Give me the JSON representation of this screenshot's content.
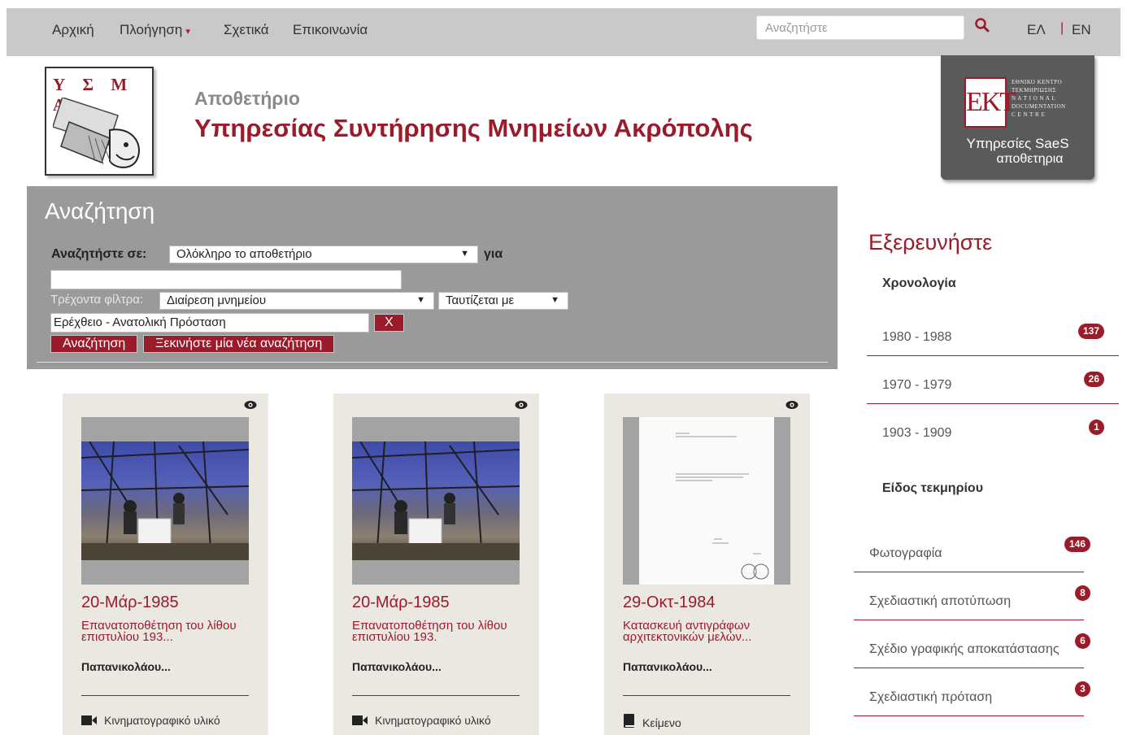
{
  "nav": {
    "home": "Αρχική",
    "browse": "Πλοήγηση",
    "about": "Σχετικά",
    "contact": "Επικοινωνία",
    "search_placeholder": "Αναζητήστε",
    "lang_el": "ΕΛ",
    "lang_sep": "|",
    "lang_en": "EN"
  },
  "header": {
    "logo_text": "Υ Σ Μ Α",
    "subtitle": "Αποθετήριο",
    "title": "Υπηρεσίας Συντήρησης Μνημείων Ακρόπολης",
    "ekt_mark": "EKT",
    "ekt_lines": [
      "ΕΘΝΙΚΟ ΚΕΝΤΡΟ",
      "ΤΕΚΜΗΡΙΩΣΗΣ",
      "N A T I O N A L",
      "DOCUMENTATION",
      "C E N T R E"
    ],
    "ekt_services": "Υπηρεσίες SaeS",
    "ekt_repos": "αποθετηρια"
  },
  "search": {
    "heading": "Αναζήτηση",
    "search_in_label": "Αναζητήστε σε:",
    "scope_value": "Ολόκληρο το αποθετήριο",
    "for_label": "για",
    "query_value": "",
    "filters_label": "Τρέχοντα φίλτρα:",
    "filter_field": "Διαίρεση μνημείου",
    "filter_op": "Ταυτίζεται με",
    "filter_value": "Ερέχθειο - Ανατολική Πρόσταση",
    "remove_label": "X",
    "search_btn": "Αναζήτηση",
    "new_search_btn": "Ξεκινήστε μία νέα αναζήτηση"
  },
  "cards": [
    {
      "date": "20-Μάρ-1985",
      "title": "Επανατοποθέτηση του λίθου επιστυλίου 193...",
      "author": "Παπανικολάου...",
      "type": "Κινηματογραφικό υλικό",
      "type_icon": "video-camera-icon"
    },
    {
      "date": "20-Μάρ-1985",
      "title": "Επανατοποθέτηση του λίθου επιστυλίου 193.",
      "author": "Παπανικολάου...",
      "type": "Κινηματογραφικό υλικό",
      "type_icon": "video-camera-icon"
    },
    {
      "date": "29-Οκτ-1984",
      "title": "Κατασκευή αντιγράφων αρχιτεκτονικών μελών...",
      "author": "Παπανικολάου...",
      "type": "Κείμενο",
      "type_icon": "book-icon"
    }
  ],
  "sidebar": {
    "heading": "Εξερευνήστε",
    "chronology_heading": "Χρονολογία",
    "chronology": [
      {
        "label": "1980 - 1988",
        "count": "137"
      },
      {
        "label": "1970 - 1979",
        "count": "26"
      },
      {
        "label": "1903 - 1909",
        "count": "1"
      }
    ],
    "type_heading": "Είδος τεκμηρίου",
    "types": [
      {
        "label": "Φωτογραφία",
        "count": "146"
      },
      {
        "label": "Σχεδιαστική αποτύπωση",
        "count": "8"
      },
      {
        "label": "Σχέδιο γραφικής αποκατάστασης",
        "count": "6"
      },
      {
        "label": "Σχεδιαστική πρόταση",
        "count": "3"
      }
    ]
  },
  "colors": {
    "accent": "#9b1b2a",
    "topbar": "#c9c9c9",
    "panel": "#9a9a9a",
    "card": "#ebe8e2"
  }
}
